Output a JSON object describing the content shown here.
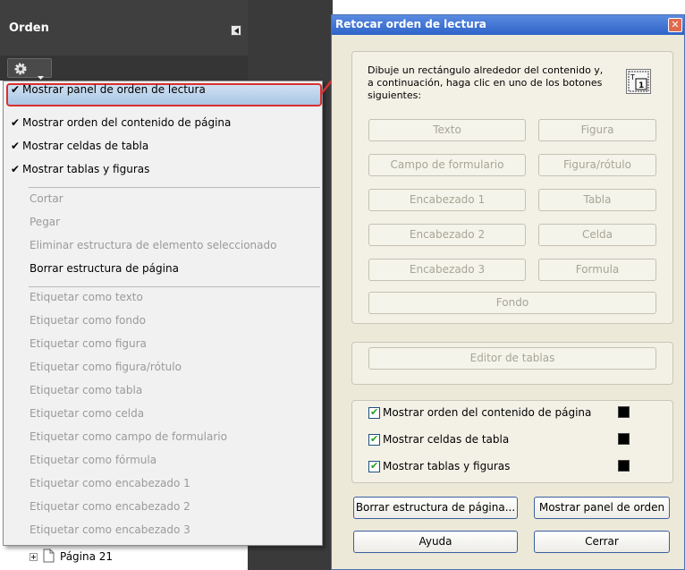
{
  "panel": {
    "title": "Orden",
    "tree_item": "Página 21"
  },
  "menu": {
    "items_checked": [
      {
        "label": "Mostrar panel de orden de lectura"
      },
      {
        "label": "Mostrar orden del contenido de página"
      },
      {
        "label": "Mostrar celdas de tabla"
      },
      {
        "label": "Mostrar tablas y figuras"
      }
    ],
    "edit_items": [
      {
        "label": "Cortar",
        "enabled": false
      },
      {
        "label": "Pegar",
        "enabled": false
      },
      {
        "label": "Eliminar estructura de elemento seleccionado",
        "enabled": false
      },
      {
        "label": "Borrar estructura de página",
        "enabled": true
      }
    ],
    "tag_items": [
      {
        "label": "Etiquetar como texto"
      },
      {
        "label": "Etiquetar como fondo"
      },
      {
        "label": "Etiquetar como figura"
      },
      {
        "label": "Etiquetar como figura/rótulo"
      },
      {
        "label": "Etiquetar como tabla"
      },
      {
        "label": "Etiquetar como celda"
      },
      {
        "label": "Etiquetar como campo de formulario"
      },
      {
        "label": "Etiquetar como fórmula"
      },
      {
        "label": "Etiquetar como encabezado 1"
      },
      {
        "label": "Etiquetar como encabezado 2"
      },
      {
        "label": "Etiquetar como encabezado 3"
      }
    ]
  },
  "dialog": {
    "title": "Retocar orden de lectura",
    "instructions": "Dibuje un rectángulo alrededor del contenido y, a continuación, haga clic en uno de los botones siguientes:",
    "tag_buttons": {
      "texto": "Texto",
      "figura": "Figura",
      "campo": "Campo de formulario",
      "figura_rotulo": "Figura/rótulo",
      "encabezado1": "Encabezado 1",
      "tabla": "Tabla",
      "encabezado2": "Encabezado 2",
      "celda": "Celda",
      "encabezado3": "Encabezado 3",
      "formula": "Formula",
      "fondo": "Fondo"
    },
    "table_editor": "Editor de tablas",
    "checkboxes": [
      {
        "label": "Mostrar orden del contenido de página",
        "checked": true,
        "color": "#000000"
      },
      {
        "label": "Mostrar celdas de tabla",
        "checked": true,
        "color": "#000000"
      },
      {
        "label": "Mostrar tablas y figuras",
        "checked": true,
        "color": "#000000"
      }
    ],
    "buttons": {
      "clear": "Borrar estructura de página...",
      "show_panel": "Mostrar panel de orden",
      "help": "Ayuda",
      "close": "Cerrar"
    }
  },
  "colors": {
    "highlight_border": "#d83030",
    "dialog_title": "#2e63c8",
    "panel_dark": "#3f3f3f"
  }
}
